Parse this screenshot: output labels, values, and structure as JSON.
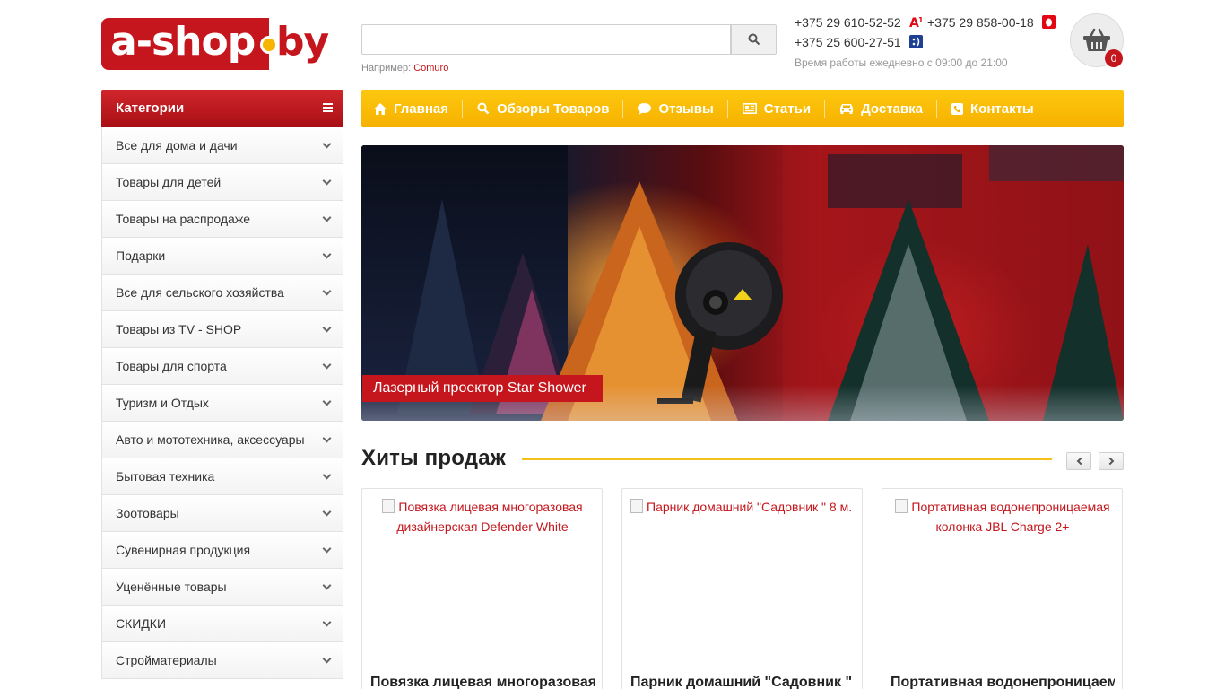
{
  "logo": {
    "left": "a-shop",
    "right": "by"
  },
  "search": {
    "placeholder": "",
    "hint_prefix": "Например:",
    "hint_link": "Comuro"
  },
  "contacts": {
    "phone_a1": "+375 29 610-52-52",
    "phone_mts": "+375 29 858-00-18",
    "phone_life": "+375 25 600-27-51",
    "hours": "Время работы ежедневно с 09:00 до 21:00"
  },
  "cart": {
    "count": "0"
  },
  "sidebar": {
    "title": "Категории",
    "items": [
      {
        "label": "Все для дома и дачи"
      },
      {
        "label": "Товары для детей"
      },
      {
        "label": "Товары на распродаже"
      },
      {
        "label": "Подарки"
      },
      {
        "label": "Все для сельского хозяйства"
      },
      {
        "label": "Товары из TV - SHOP"
      },
      {
        "label": "Товары для спорта"
      },
      {
        "label": "Туризм и Отдых"
      },
      {
        "label": "Авто и мототехника, аксессуары"
      },
      {
        "label": "Бытовая техника"
      },
      {
        "label": "Зоотовары"
      },
      {
        "label": "Сувенирная продукция"
      },
      {
        "label": "Уценённые товары"
      },
      {
        "label": "СКИДКИ"
      },
      {
        "label": "Стройматериалы"
      }
    ]
  },
  "nav": {
    "items": [
      {
        "label": "Главная",
        "icon": "home-icon"
      },
      {
        "label": "Обзоры Товаров",
        "icon": "search-icon"
      },
      {
        "label": "Отзывы",
        "icon": "comment-icon"
      },
      {
        "label": "Статьи",
        "icon": "newspaper-icon"
      },
      {
        "label": "Доставка",
        "icon": "car-icon"
      },
      {
        "label": "Контакты",
        "icon": "phone-icon"
      }
    ]
  },
  "banner": {
    "caption": "Лазерный проектор Star Shower"
  },
  "hits": {
    "title": "Хиты продаж",
    "products": [
      {
        "alt": "Повязка лицевая многоразовая дизайнерская Defender White",
        "name": "Повязка лицевая многоразовая дизайнерская Defender White"
      },
      {
        "alt": "Парник домашний \"Садовник \" 8 м.",
        "name": "Парник домашний \"Садовник \" 8 м."
      },
      {
        "alt": "Портативная водонепроницаемая колонка JBL Charge 2+",
        "name": "Портативная водонепроницаемая колонка JBL Charge 2+"
      }
    ]
  },
  "colors": {
    "brand_red": "#c4161c",
    "brand_yellow": "#f7b500"
  }
}
